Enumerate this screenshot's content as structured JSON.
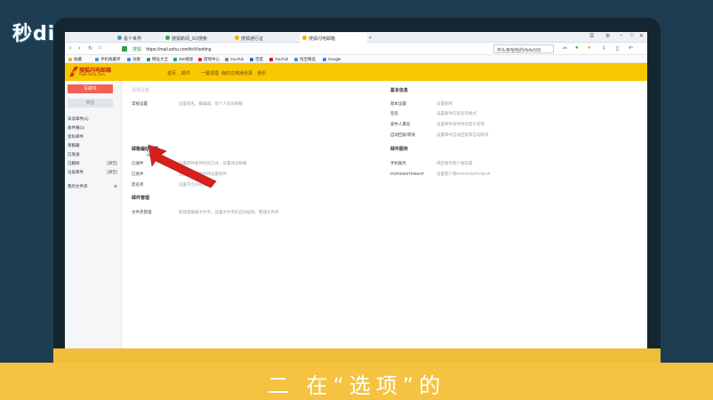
{
  "watermark": {
    "logo_text": "秒ding视频"
  },
  "subtitle": "二 在“选项”的",
  "browser": {
    "tabs": [
      {
        "label": "看个世界"
      },
      {
        "label": "搜狐新闻_SO搜索"
      },
      {
        "label": "搜狐通行证"
      },
      {
        "label": "搜狐闪电邮箱"
      }
    ],
    "new_tab": "+",
    "url": "https://mail.sohu.com/fe/#/setting",
    "secure_label": "搜狐",
    "search_placeholder": "怀头条哈哈的#b4e500",
    "bookmarks": [
      "收藏",
      "手机收藏夹",
      "谷歌",
      "网址大全",
      "360搜索",
      "游戏中心",
      "YouTub",
      "百度",
      "YouTub",
      "淘宝精选",
      "Google"
    ]
  },
  "app": {
    "brand_name": "搜狐闪电邮箱",
    "brand_domain": "mail.sohu.com",
    "nav": [
      "首页",
      "邮件",
      "一键清理",
      "我的文档",
      "通讯录",
      "通讯"
    ],
    "compose_label": "写邮件",
    "receive_label": "收信",
    "folders": [
      {
        "name": "未读邮件(1)",
        "action": ""
      },
      {
        "name": "收件箱(1)",
        "action": ""
      },
      {
        "name": "星标邮件",
        "action": ""
      },
      {
        "name": "草稿箱",
        "action": ""
      },
      {
        "name": "已发送",
        "action": ""
      },
      {
        "name": "已删除",
        "action": "[清空]"
      },
      {
        "name": "垃圾邮件",
        "action": "[清空]"
      },
      {
        "name": "我的文件夹",
        "action": "⚙"
      }
    ]
  },
  "settings": {
    "left": {
      "blurred_title": "常规设置",
      "general_row": {
        "label": "常规设置",
        "desc": "设置签名、编辑器、等个人化的邮箱"
      },
      "section_title": "邮箱偏好设置",
      "rows": [
        {
          "label": "已收件",
          "desc": "设置邮件收件时的方式、设置阅读邮箱"
        },
        {
          "label": "已发件",
          "desc": "设置邮件发件时的设置邮件"
        },
        {
          "label": "黑名单",
          "desc": "设置不允许的发件人"
        }
      ],
      "manage_title": "邮件管理",
      "manage_rows": [
        {
          "label": "文件夹管理",
          "desc": "新建或编辑文件夹、设置文件夹的自动规则、整理文件夹"
        }
      ]
    },
    "right": {
      "section_title": "基本信息",
      "rows": [
        {
          "label": "基本设置",
          "desc": "设置昵称"
        },
        {
          "label": "签名",
          "desc": "设置邮件的签名的格式"
        },
        {
          "label": "发件人署名",
          "desc": "设置邮件发件时的显示名称"
        },
        {
          "label": "自动回复/转发",
          "desc": "设置邮件自动回复和自动转发"
        }
      ],
      "service_title": "邮件服务",
      "service_rows": [
        {
          "label": "手机服务",
          "desc": "绑定邮件客户端设置"
        },
        {
          "label": "POP3/SMTP/IMAP",
          "desc": "设置客户端POP3/SMTP/IMAP"
        }
      ]
    }
  },
  "colors": {
    "accent_yellow": "#f9c800",
    "compose_red": "#f26051",
    "arrow_red": "#d81f1f",
    "bottom_band": "#f5c341"
  }
}
